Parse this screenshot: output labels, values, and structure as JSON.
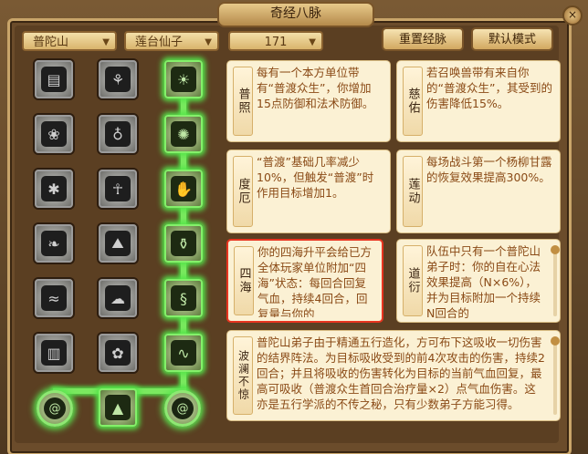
{
  "window": {
    "title": "奇经八脉",
    "close_glyph": "×"
  },
  "filters": {
    "school": "普陀山",
    "pet": "莲台仙子",
    "level": "171"
  },
  "buttons": {
    "reset": "重置经脉",
    "default": "默认模式"
  },
  "grid": {
    "col1": [
      "book-icon",
      "lotus-icon",
      "spider-icon",
      "feather-icon",
      "wave-icon",
      "scroll-icon"
    ],
    "col2": [
      "crane-icon",
      "bell-icon",
      "idol-icon",
      "mountain-icon",
      "cloud-icon",
      "flower-icon"
    ],
    "col3": [
      "sun-icon",
      "paw-icon",
      "hand-icon",
      "vase-icon",
      "serpent-icon",
      "tide-icon"
    ],
    "bottom": [
      "swirl-left-icon",
      "landscape-icon",
      "swirl-right-icon"
    ]
  },
  "cards": [
    {
      "title": "普照",
      "text": "每有一个本方单位带有“普渡众生”，你增加15点防御和法术防御。"
    },
    {
      "title": "慈佑",
      "text": "若召唤兽带有来自你的“普渡众生”，其受到的伤害降低15%。"
    },
    {
      "title": "度厄",
      "text": "“普渡”基础几率减少10%，但触发“普渡”时作用目标增加1。"
    },
    {
      "title": "莲动",
      "text": "每场战斗第一个杨柳甘露的恢复效果提高300%。"
    },
    {
      "title": "四海",
      "text": "你的四海升平会给已方全体玩家单位附加“四海”状态：每回合回复气血，持续4回合，回复量与你的"
    },
    {
      "title": "道衍",
      "text": "队伍中只有一个普陀山弟子时：你的自在心法效果提高（N×6%），并为目标附加一个持续N回合的"
    },
    {
      "title": "波澜不惊",
      "text": "普陀山弟子由于精通五行造化，方可布下这吸收一切伤害的结界阵法。为目标吸收受到的前4次攻击的伤害，持续2回合；并且将吸收的伤害转化为目标的当前气血回复，最高可吸收（普渡众生首回合治疗量×2）点气血伤害。这亦是五行学派的不传之秘，只有少数弟子方能习得。"
    }
  ]
}
